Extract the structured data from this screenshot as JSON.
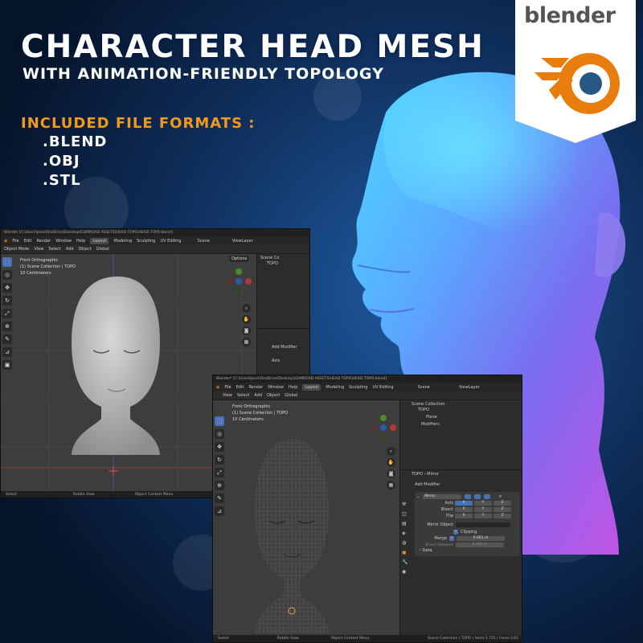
{
  "hero": {
    "title": "CHARACTER HEAD MESH",
    "subtitle": "WITH ANIMATION-FRIENDLY TOPOLOGY",
    "formats_label": "INCLUDED FILE FORMATS :",
    "formats": [
      ".BLEND",
      ".OBJ",
      ".STL"
    ]
  },
  "logo": {
    "text": "blender",
    "accent": "#e87d0d",
    "core": "#265787"
  },
  "colors": {
    "orange": "#f09a1d",
    "bg": "#0a1b33",
    "ui_active": "#4772b3"
  },
  "window1": {
    "title": "Blender [C:\\Users\\Jessi\\OneDrive\\Desktop\\GUMROAD ASSETS\\HEAD TOPO\\HEAD TOPO.blend]",
    "menu": [
      "Blender",
      "File",
      "Edit",
      "Render",
      "Window",
      "Help"
    ],
    "workspaces": [
      "Layout",
      "Modeling",
      "Sculpting",
      "UV Editing"
    ],
    "scene": "Scene",
    "view_layer": "ViewLayer",
    "header": [
      "Object Mode",
      "View",
      "Select",
      "Add",
      "Object",
      "Global",
      "Options"
    ],
    "viewport_info": [
      "Front Orthographic",
      "(1) Scene Collection | TOPO",
      "10 Centimeters"
    ],
    "outliner": [
      "Scene Co",
      "TOPO"
    ],
    "props": [
      "Add Modifier",
      "Axis"
    ],
    "status": [
      "Select",
      "Rotate View",
      "Object Context Menu"
    ]
  },
  "window2": {
    "title": "Blender* [C:\\Users\\Jessi\\OneDrive\\Desktop\\GUMROAD ASSETS\\HEAD TOPO\\HEAD TOPO.blend]",
    "menu": [
      "Blender",
      "File",
      "Edit",
      "Render",
      "Window",
      "Help"
    ],
    "workspaces": [
      "Layout",
      "Modeling",
      "Sculpting",
      "UV Editing"
    ],
    "scene": "Scene",
    "view_layer": "ViewLayer",
    "header": [
      "View",
      "Select",
      "Add",
      "Object",
      "Global"
    ],
    "viewport_info": [
      "Front Orthographic",
      "(1) Scene Collection | TOPO",
      "10 Centimeters"
    ],
    "outliner": [
      "Scene Collection",
      "TOPO",
      "Plane",
      "Modifiers"
    ],
    "breadcrumb": [
      "TOPO",
      "Mirror"
    ],
    "add_modifier": "Add Modifier",
    "modifier_name": "Mirror",
    "rows": [
      {
        "label": "Axis",
        "cells": [
          "X",
          "Y",
          "Z"
        ]
      },
      {
        "label": "Bisect",
        "cells": [
          "X",
          "Y",
          "Z"
        ]
      },
      {
        "label": "Flip",
        "cells": [
          "X",
          "Y",
          "Z"
        ]
      }
    ],
    "mirror_object": "Mirror Object",
    "clipping": "Clipping",
    "merge_label": "Merge",
    "merge_value": "0.001 m",
    "bisect_distance_label": "Bisect Distance",
    "bisect_distance_value": "0.001 m",
    "data_label": "Data",
    "status": [
      "Select",
      "Rotate View",
      "Object Context Menu"
    ],
    "status_right": "Scene Collection | TOPO | Verts:3,725 | Faces:3,65"
  }
}
